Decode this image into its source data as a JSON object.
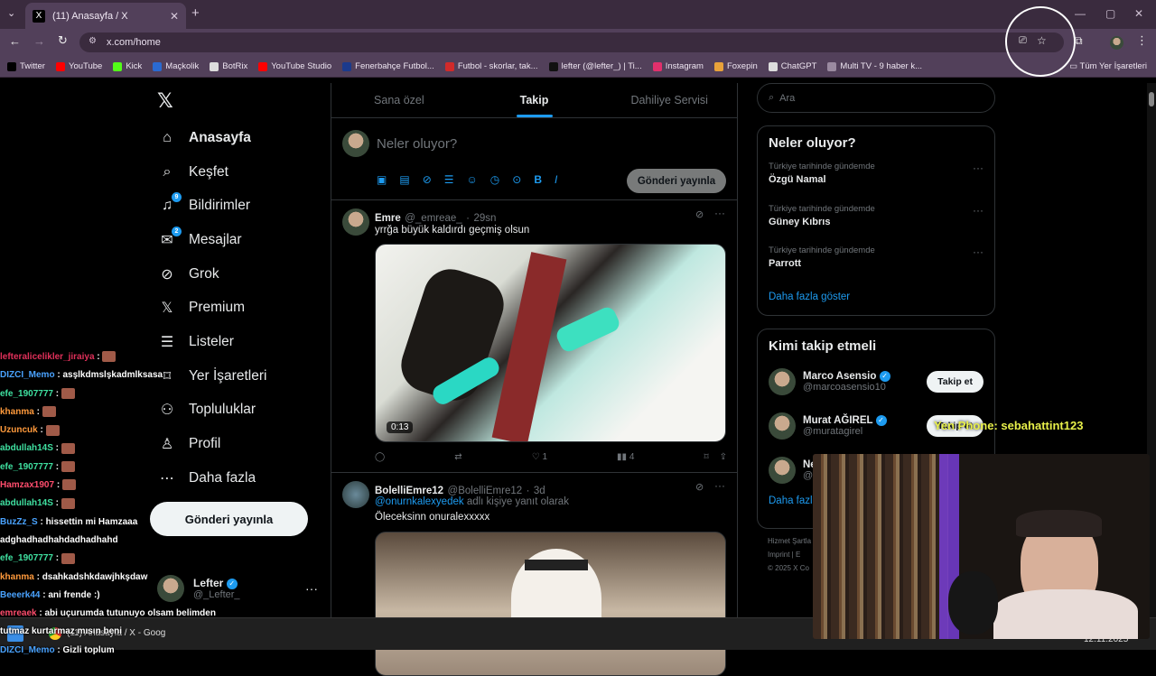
{
  "browser": {
    "tab_title": "(11) Anasayfa / X",
    "url": "x.com/home",
    "bookmarks": [
      {
        "label": "Twitter",
        "color": "#000000"
      },
      {
        "label": "YouTube",
        "color": "#ff0000"
      },
      {
        "label": "Kick",
        "color": "#53fc18"
      },
      {
        "label": "Maçkolik",
        "color": "#2a6ad1"
      },
      {
        "label": "BotRix",
        "color": "#dddddd"
      },
      {
        "label": "YouTube Studio",
        "color": "#ff0000"
      },
      {
        "label": "Fenerbahçe Futbol...",
        "color": "#1b3a8c"
      },
      {
        "label": "Futbol - skorlar, tak...",
        "color": "#d12a2a"
      },
      {
        "label": "lefter (@lefter_) | Ti...",
        "color": "#111111"
      },
      {
        "label": "Instagram",
        "color": "#e1306c"
      },
      {
        "label": "Foxepin",
        "color": "#e8a23a"
      },
      {
        "label": "ChatGPT",
        "color": "#dddddd"
      },
      {
        "label": "Multi TV - 9 haber k...",
        "color": "#9a8aa0"
      }
    ],
    "all_bookmarks": "Tüm Yer İşaretleri"
  },
  "nav": {
    "items": [
      {
        "label": "Anasayfa",
        "icon": "home-icon",
        "active": true
      },
      {
        "label": "Keşfet",
        "icon": "search-icon"
      },
      {
        "label": "Bildirimler",
        "icon": "bell-icon",
        "badge": "9"
      },
      {
        "label": "Mesajlar",
        "icon": "mail-icon",
        "badge": "2"
      },
      {
        "label": "Grok",
        "icon": "grok-icon"
      },
      {
        "label": "Premium",
        "icon": "x-logo-icon"
      },
      {
        "label": "Listeler",
        "icon": "list-icon"
      },
      {
        "label": "Yer İşaretleri",
        "icon": "bookmark-icon"
      },
      {
        "label": "Topluluklar",
        "icon": "communities-icon"
      },
      {
        "label": "Profil",
        "icon": "profile-icon"
      },
      {
        "label": "Daha fazla",
        "icon": "more-icon"
      }
    ],
    "post_button": "Gönderi yayınla",
    "profile_name": "Lefter",
    "profile_handle": "@_Lefter_"
  },
  "feed": {
    "tabs": [
      "Sana özel",
      "Takip",
      "Dahiliye Servisi"
    ],
    "active_tab": 1,
    "composer_placeholder": "Neler oluyor?",
    "composer_button": "Gönderi yayınla",
    "tweets": [
      {
        "name": "Emre",
        "handle": "@_emreae_",
        "time": "29sn",
        "text": "yrrğa büyük kaldırdı geçmiş olsun",
        "video_time": "0:13",
        "likes": "1",
        "views": "4"
      },
      {
        "name": "BolelliEmre12",
        "handle": "@BolelliEmre12",
        "time": "3d",
        "reply_to": "@onurnkalexyedek",
        "reply_suffix": " adlı kişiye yanıt olarak",
        "text": "Öleceksinn onuralexxxxx"
      }
    ]
  },
  "sidebar": {
    "search_placeholder": "Ara",
    "trends_title": "Neler oluyor?",
    "trends": [
      {
        "context": "Türkiye tarihinde gündemde",
        "topic": "Özgü Namal"
      },
      {
        "context": "Türkiye tarihinde gündemde",
        "topic": "Güney Kıbrıs"
      },
      {
        "context": "Türkiye tarihinde gündemde",
        "topic": "Parrott"
      }
    ],
    "show_more": "Daha fazla göster",
    "who_title": "Kimi takip etmeli",
    "who": [
      {
        "name": "Marco Asensio",
        "handle": "@marcoasensio10",
        "button": "Takip et"
      },
      {
        "name": "Murat AĞIREL",
        "handle": "@muratagirel",
        "button": "Takip et"
      },
      {
        "name": "Ne",
        "handle": "@N"
      }
    ],
    "who_more": "Daha fazl",
    "footer": [
      "Hizmet Şartla",
      "Imprint",
      "E",
      "© 2025 X Co"
    ]
  },
  "overlay": {
    "phone_text": "Yen Phone: sebahattint123",
    "chat": [
      {
        "user": "lefteralicelikler_jiraiya",
        "color": "#e0305a",
        "msg": "",
        "emote": true
      },
      {
        "user": "DIZCI_Memo",
        "color": "#4aa3ff",
        "msg": "asşlkdmslşkadmlksasa",
        "emote": false
      },
      {
        "user": "efe_1907777",
        "color": "#3fe0a0",
        "msg": "",
        "emote": true
      },
      {
        "user": "khanma",
        "color": "#ff9a3c",
        "msg": "",
        "emote": true
      },
      {
        "user": "Uzuncuk",
        "color": "#ff9a3c",
        "msg": "",
        "emote": true
      },
      {
        "user": "abdullah14S",
        "color": "#3fe0a0",
        "msg": "",
        "emote": true
      },
      {
        "user": "efe_1907777",
        "color": "#3fe0a0",
        "msg": "",
        "emote": true
      },
      {
        "user": "Hamzax1907",
        "color": "#ff4d6d",
        "msg": "",
        "emote": true
      },
      {
        "user": "abdullah14S",
        "color": "#3fe0a0",
        "msg": "",
        "emote": true
      },
      {
        "user": "BuzZz_S",
        "color": "#4aa3ff",
        "msg": "hissettin mi Hamzaaa",
        "emote": false
      },
      {
        "user": "",
        "color": "#ffffff",
        "msg": "adghadhadhahdadhadhahd",
        "emote": false
      },
      {
        "user": "efe_1907777",
        "color": "#3fe0a0",
        "msg": "",
        "emote": true
      },
      {
        "user": "khanma",
        "color": "#ff9a3c",
        "msg": "dsahkadshkdawjhkşdaw",
        "emote": false
      },
      {
        "user": "Beeerk44",
        "color": "#4aa3ff",
        "msg": "ani frende :)",
        "emote": false
      },
      {
        "user": "emreaek",
        "color": "#ff4d6d",
        "msg": "abi uçurumda tutunuyo olsam belimden",
        "emote": false
      },
      {
        "user": "",
        "color": "#ffffff",
        "msg": "tutmaz kurtarmaz mısın beni",
        "emote": false
      },
      {
        "user": "DIZCI_Memo",
        "color": "#4aa3ff",
        "msg": "Gizli toplum",
        "emote": false
      }
    ],
    "taskbar_label": "(11) Anasayfa / X - Goog",
    "clock": "12.11.2025"
  }
}
